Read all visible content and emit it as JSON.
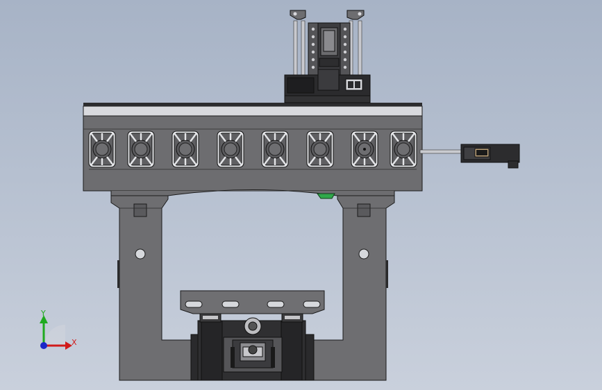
{
  "view": {
    "background_top": "#a7b3c6",
    "background_bottom": "#c9d0dc",
    "body_color": "#6d6d70",
    "edge_color": "#1a1a1a",
    "dark_part_color": "#2a2a2c"
  },
  "triad": {
    "x_label": "X",
    "y_label": "Y",
    "x_color": "#d11a1a",
    "y_color": "#1faa1f",
    "z_color": "#1c28c8"
  },
  "crossbeam": {
    "pocket_count": 8
  },
  "table": {
    "slot_count": 4
  }
}
